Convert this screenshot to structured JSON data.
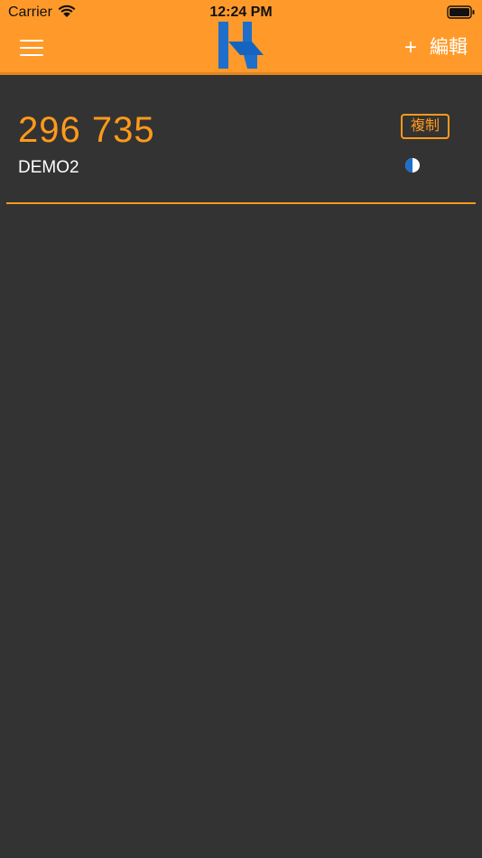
{
  "status_bar": {
    "carrier": "Carrier",
    "time": "12:24 PM"
  },
  "header": {
    "add_label": "+",
    "edit_label": "編輯",
    "background_color": "#FF9A2A"
  },
  "tokens": [
    {
      "code": "296 735",
      "name": "DEMO2",
      "copy_label": "複制",
      "timer_progress": 0.5
    }
  ],
  "colors": {
    "accent": "#FF9A1A",
    "background": "#333333",
    "logo_blue": "#1E6FCB"
  }
}
